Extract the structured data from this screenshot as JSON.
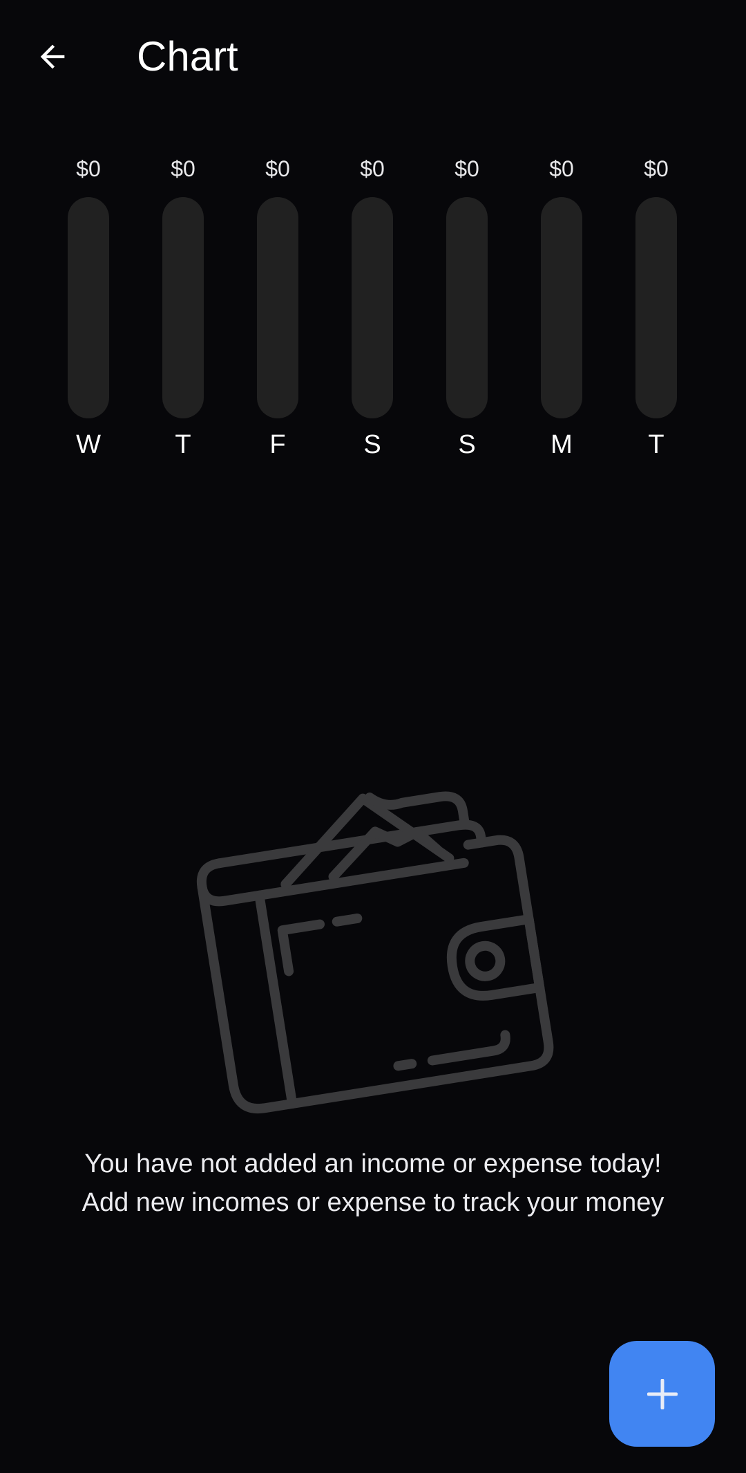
{
  "app_bar": {
    "title": "Chart",
    "back_icon": "arrow-left-icon"
  },
  "chart_data": {
    "type": "bar",
    "categories": [
      "W",
      "T",
      "F",
      "S",
      "S",
      "M",
      "T"
    ],
    "values": [
      0,
      0,
      0,
      0,
      0,
      0,
      0
    ],
    "value_labels": [
      "$0",
      "$0",
      "$0",
      "$0",
      "$0",
      "$0",
      "$0"
    ],
    "title": "",
    "xlabel": "",
    "ylabel": ""
  },
  "empty_state": {
    "icon": "wallet-icon",
    "line1": "You have not added an income or expense today!",
    "line2": "Add new incomes or expense to track your money"
  },
  "fab": {
    "icon": "plus-icon",
    "color": "#4185f2"
  },
  "colors": {
    "background": "#07070a",
    "bar_track": "#212121",
    "accent": "#4185f2"
  }
}
